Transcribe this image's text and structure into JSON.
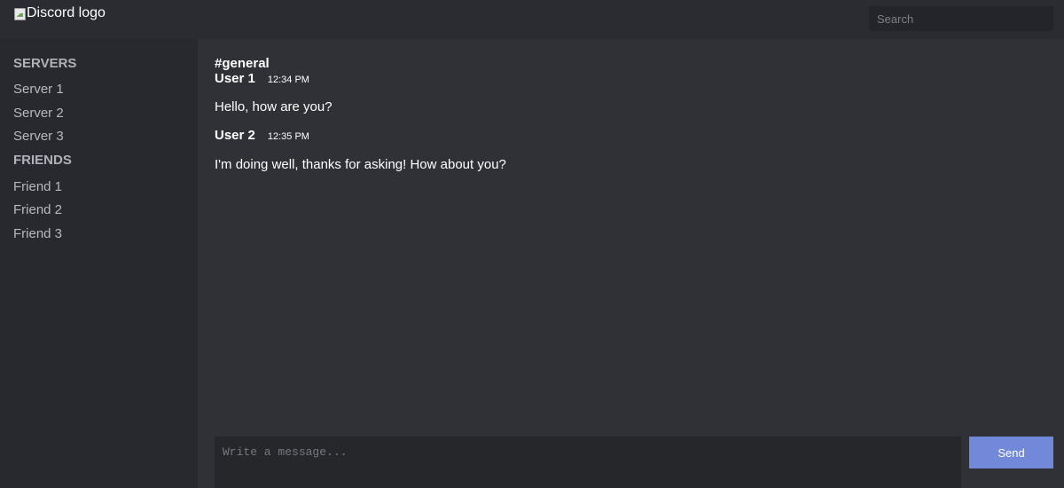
{
  "header": {
    "logo_alt": "Discord logo",
    "search_placeholder": "Search"
  },
  "sidebar": {
    "servers_title": "SERVERS",
    "servers": [
      "Server 1",
      "Server 2",
      "Server 3"
    ],
    "friends_title": "FRIENDS",
    "friends": [
      "Friend 1",
      "Friend 2",
      "Friend 3"
    ]
  },
  "chat": {
    "channel": "#general",
    "messages": [
      {
        "user": "User 1",
        "time": "12:34 PM",
        "text": "Hello, how are you?"
      },
      {
        "user": "User 2",
        "time": "12:35 PM",
        "text": "I'm doing well, thanks for asking! How about you?"
      }
    ]
  },
  "composer": {
    "placeholder": "Write a message...",
    "send_label": "Send"
  },
  "colors": {
    "accent": "#7289da",
    "background": "#303136",
    "sidebar": "#28292e",
    "header": "#2b2c31"
  }
}
